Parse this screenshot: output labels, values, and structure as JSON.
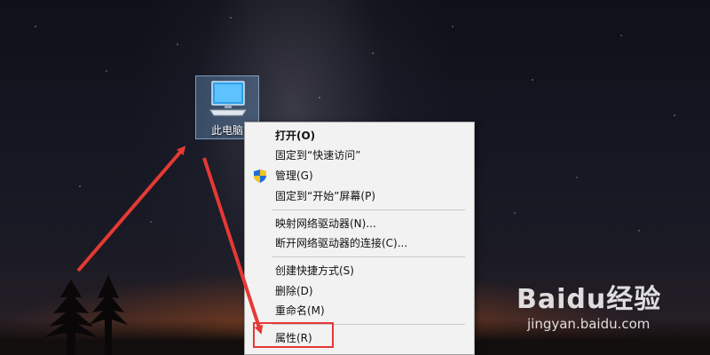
{
  "desktop": {
    "icon_label": "此电脑"
  },
  "context_menu": {
    "groups": [
      [
        {
          "label": "打开(O)",
          "bold": true
        },
        {
          "label": "固定到“快速访问”"
        },
        {
          "label": "管理(G)",
          "icon": "uac-shield-icon"
        },
        {
          "label": "固定到“开始”屏幕(P)"
        }
      ],
      [
        {
          "label": "映射网络驱动器(N)..."
        },
        {
          "label": "断开网络驱动器的连接(C)..."
        }
      ],
      [
        {
          "label": "创建快捷方式(S)"
        },
        {
          "label": "删除(D)"
        },
        {
          "label": "重命名(M)"
        }
      ],
      [
        {
          "label": "属性(R)",
          "highlighted": true
        }
      ]
    ]
  },
  "watermark": {
    "brand": "Baidu经验",
    "url": "jingyan.baidu.com"
  },
  "colors": {
    "annotation_red": "#e53935",
    "menu_bg": "#f2f2f2"
  }
}
